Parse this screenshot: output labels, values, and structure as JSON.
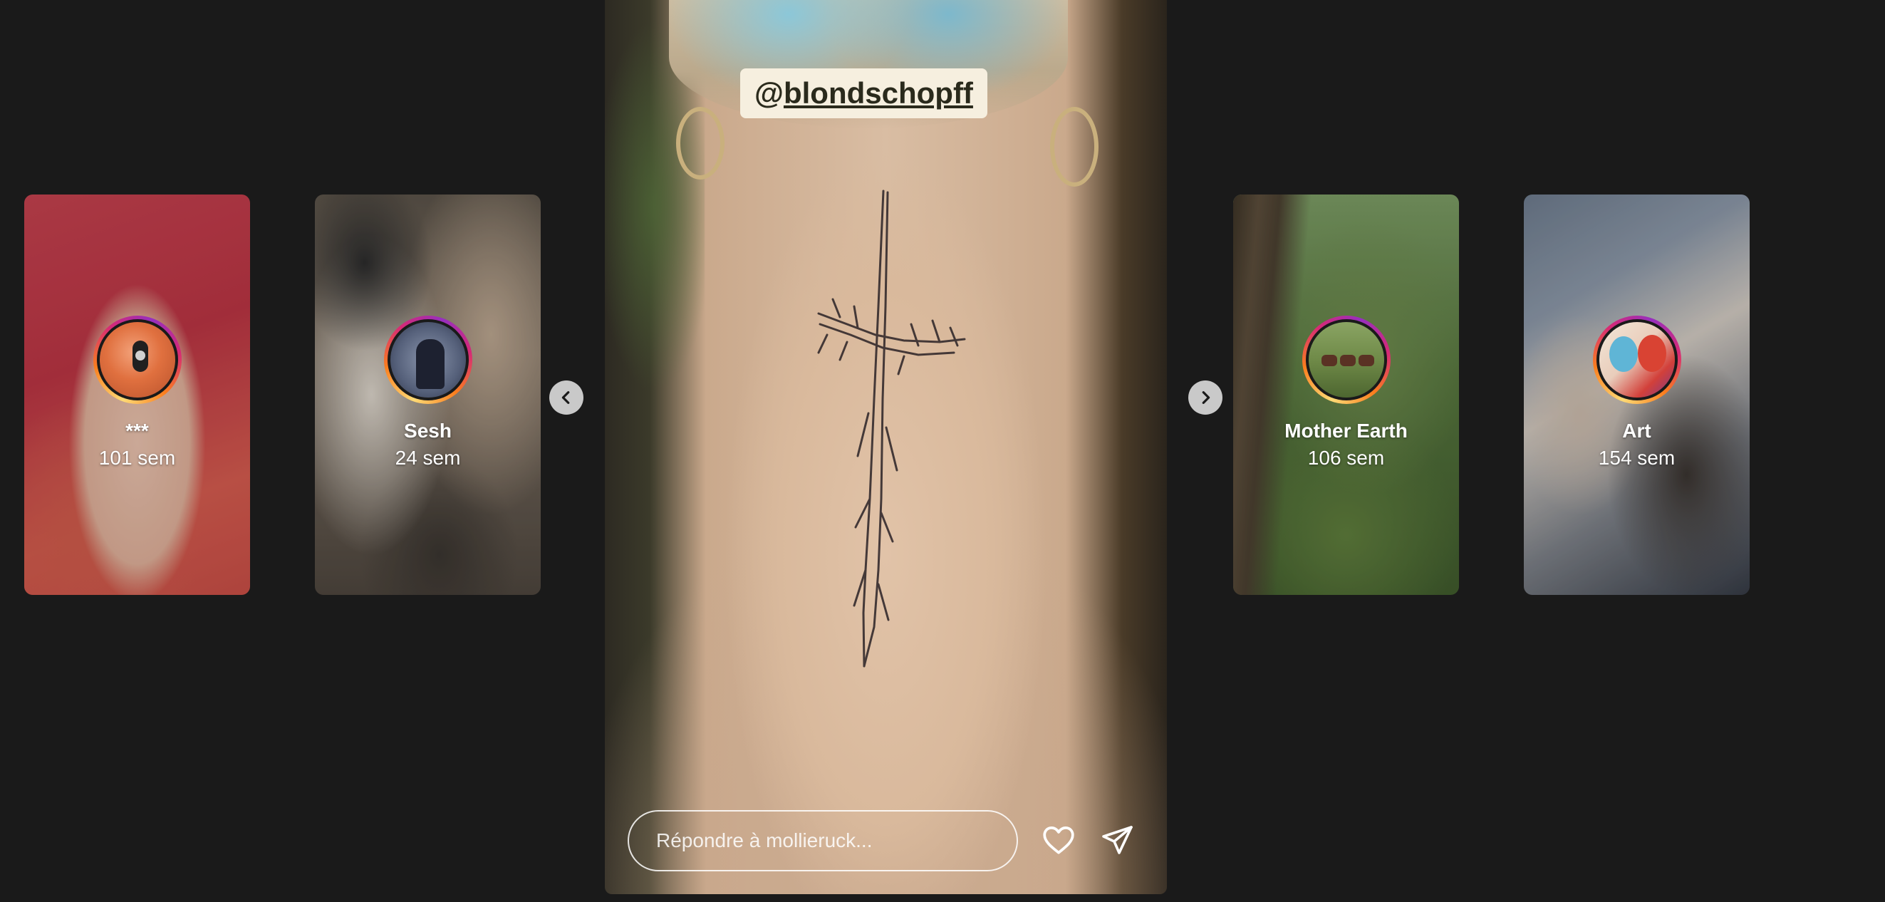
{
  "story": {
    "mention": "@blondschopff",
    "mention_at": "@",
    "mention_handle": "blondschopff",
    "reply_placeholder": "Répondre à mollieruck..."
  },
  "highlights": [
    {
      "name": "***",
      "time": "101 sem"
    },
    {
      "name": "Sesh",
      "time": "24 sem"
    },
    {
      "name": "Mother Earth",
      "time": "106 sem"
    },
    {
      "name": "Art",
      "time": "154 sem"
    }
  ],
  "icons": {
    "prev": "chevron-left-icon",
    "next": "chevron-right-icon",
    "like": "heart-icon",
    "send": "paper-plane-icon"
  },
  "colors": {
    "background": "#1a1a1a",
    "ring_gradient": [
      "#feda75",
      "#fa7e1e",
      "#d62976",
      "#962fbf"
    ],
    "tag_background": "#f6efdf"
  }
}
